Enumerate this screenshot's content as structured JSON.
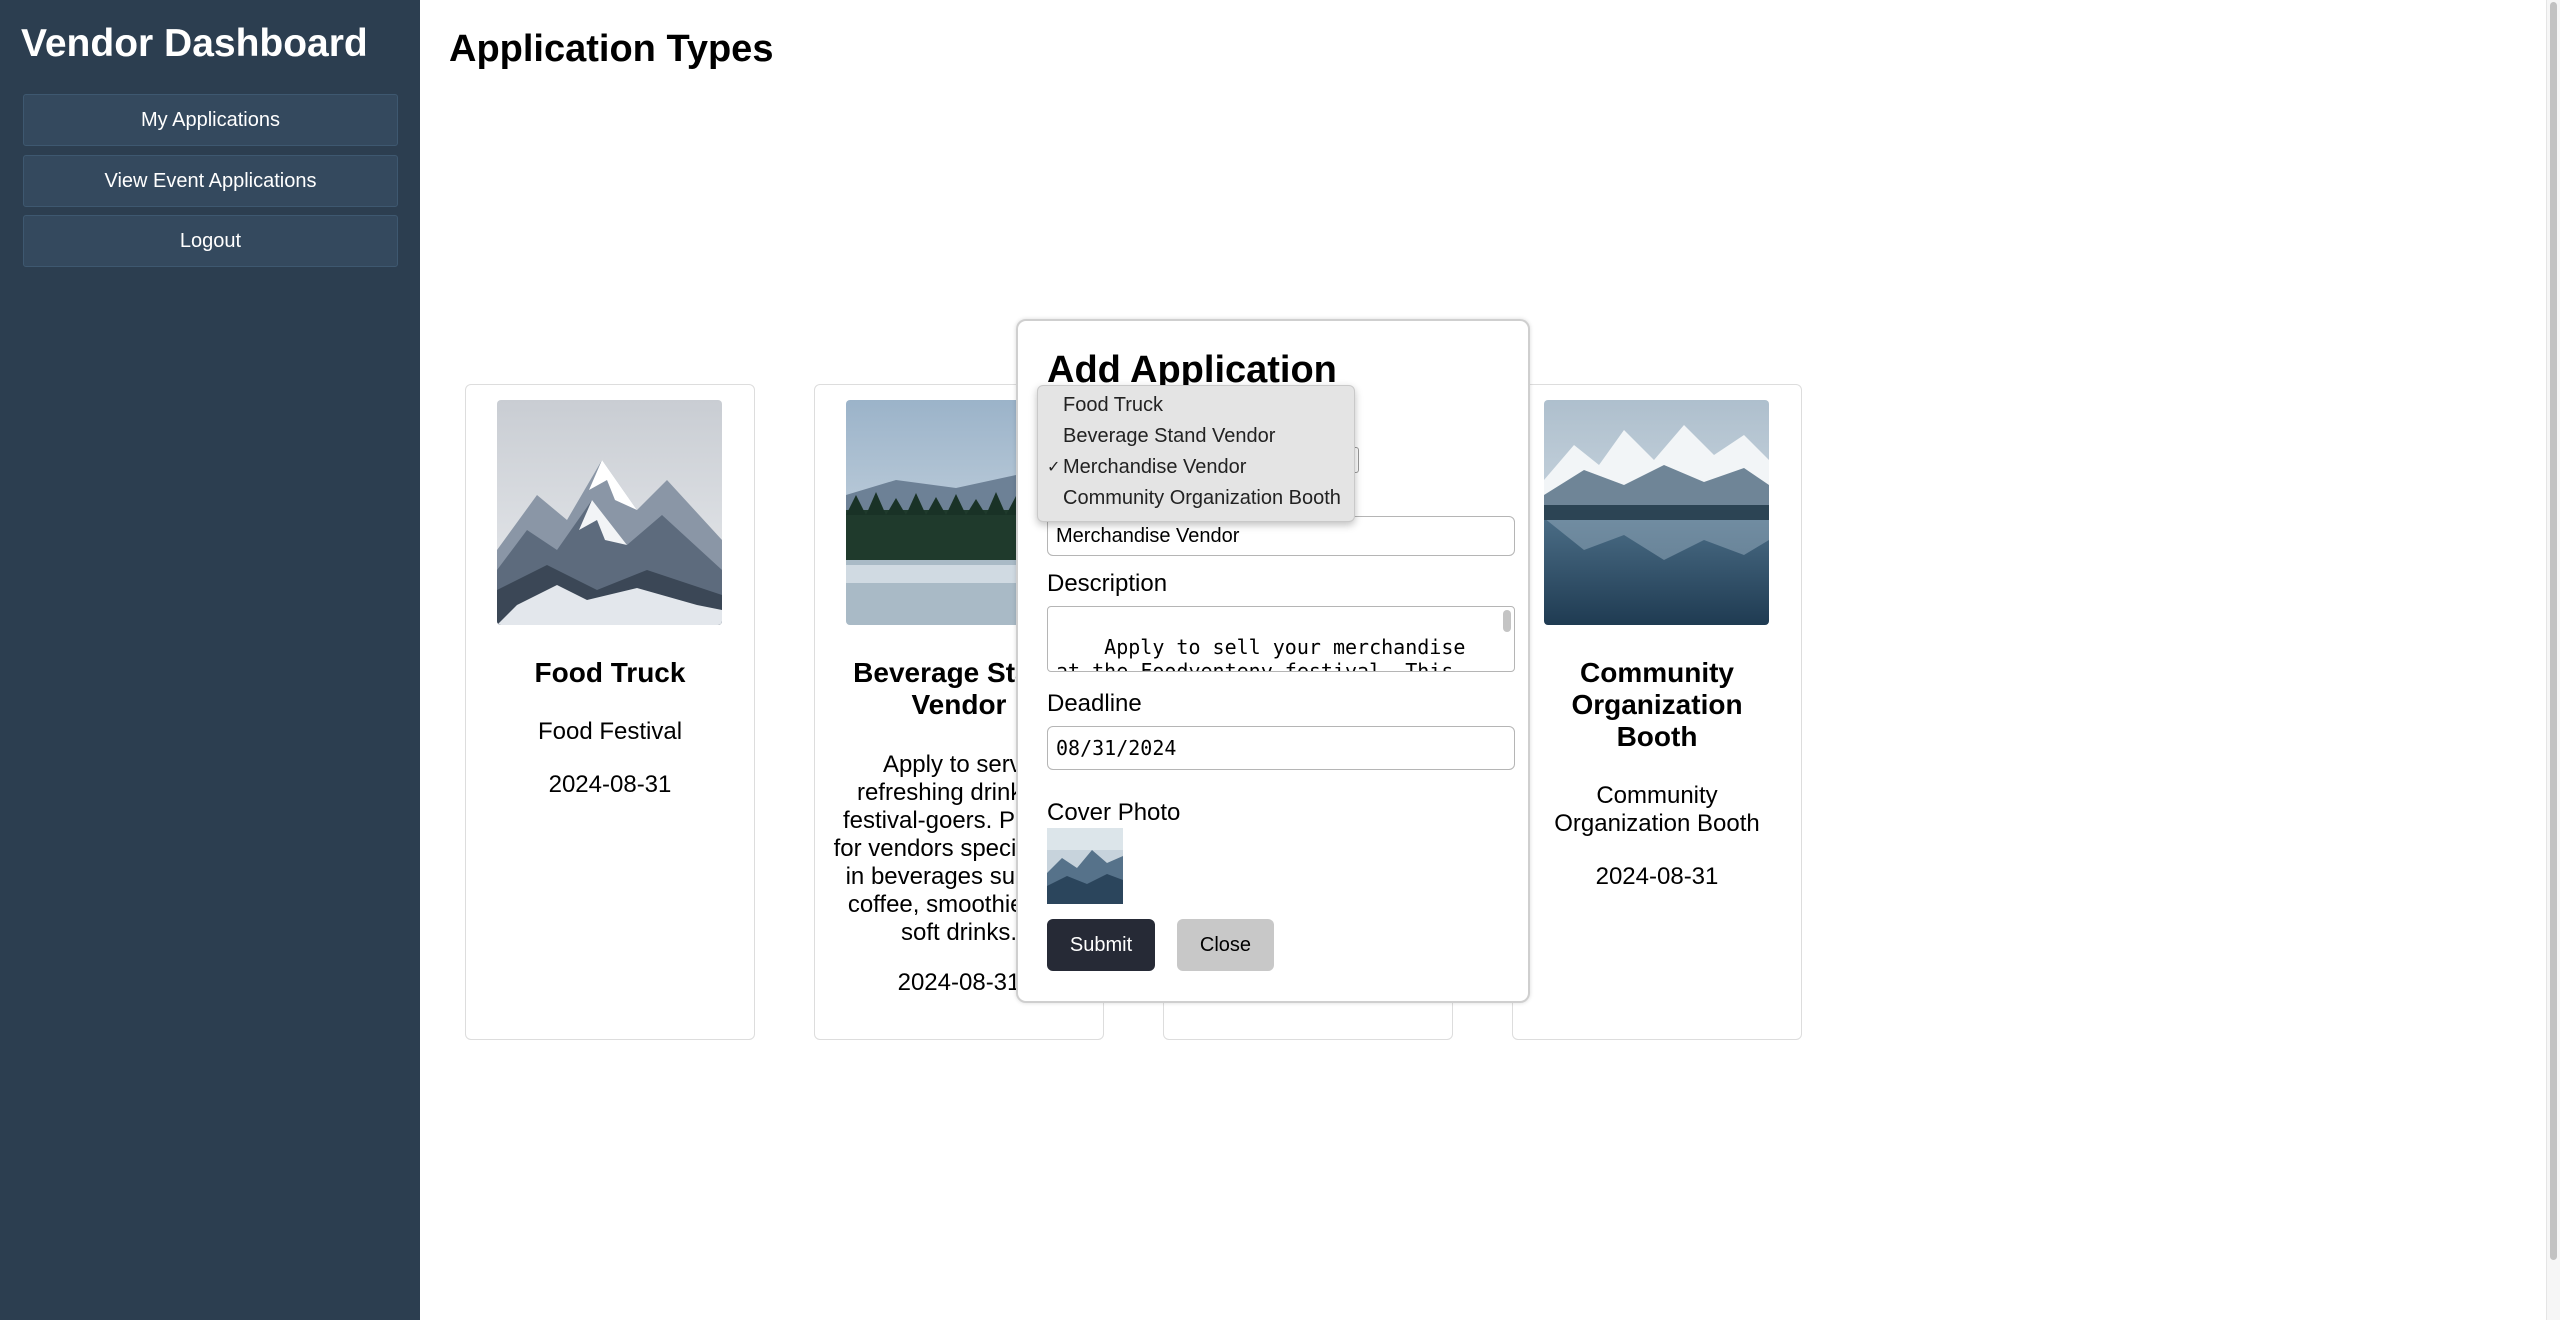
{
  "sidebar": {
    "title": "Vendor Dashboard",
    "items": [
      {
        "label": "My Applications"
      },
      {
        "label": "View Event Applications"
      },
      {
        "label": "Logout"
      }
    ]
  },
  "main": {
    "title": "Application Types",
    "cards": [
      {
        "title": "Food Truck",
        "subtitle": "Food Festival",
        "date": "2024-08-31",
        "image": "snowy-mountains-photo"
      },
      {
        "title": "Beverage Stand Vendor",
        "description": "Apply to serve refreshing drinks to festival-goers. Perfect for vendors specializing in beverages such as coffee, smoothies, or soft drinks.",
        "date": "2024-08-31",
        "image": "forest-lake-photo"
      },
      {
        "title": "Community Organization Booth",
        "subtitle": "Community Organization Booth",
        "date": "2024-08-31",
        "image": "alpine-lake-photo"
      }
    ]
  },
  "modal": {
    "title": "Add Application",
    "dropdown": {
      "options": [
        "Food Truck",
        "Beverage Stand Vendor",
        "Merchandise Vendor",
        "Community Organization Booth"
      ],
      "selected": "Merchandise Vendor",
      "check_mark": "✓"
    },
    "name_value": "Merchandise Vendor",
    "description_label": "Description",
    "description_value": "Apply to sell your merchandise at the Foodventeny festival. This could include handmade crafts, apparel",
    "deadline_label": "Deadline",
    "deadline_value": "08/31/2024",
    "cover_label": "Cover Photo",
    "submit_label": "Submit",
    "close_label": "Close"
  },
  "colors": {
    "sidebar_bg": "#2c3e50",
    "sidebar_button_bg": "#34495e",
    "submit_bg": "#262a36",
    "close_bg": "#c8c8c8"
  }
}
